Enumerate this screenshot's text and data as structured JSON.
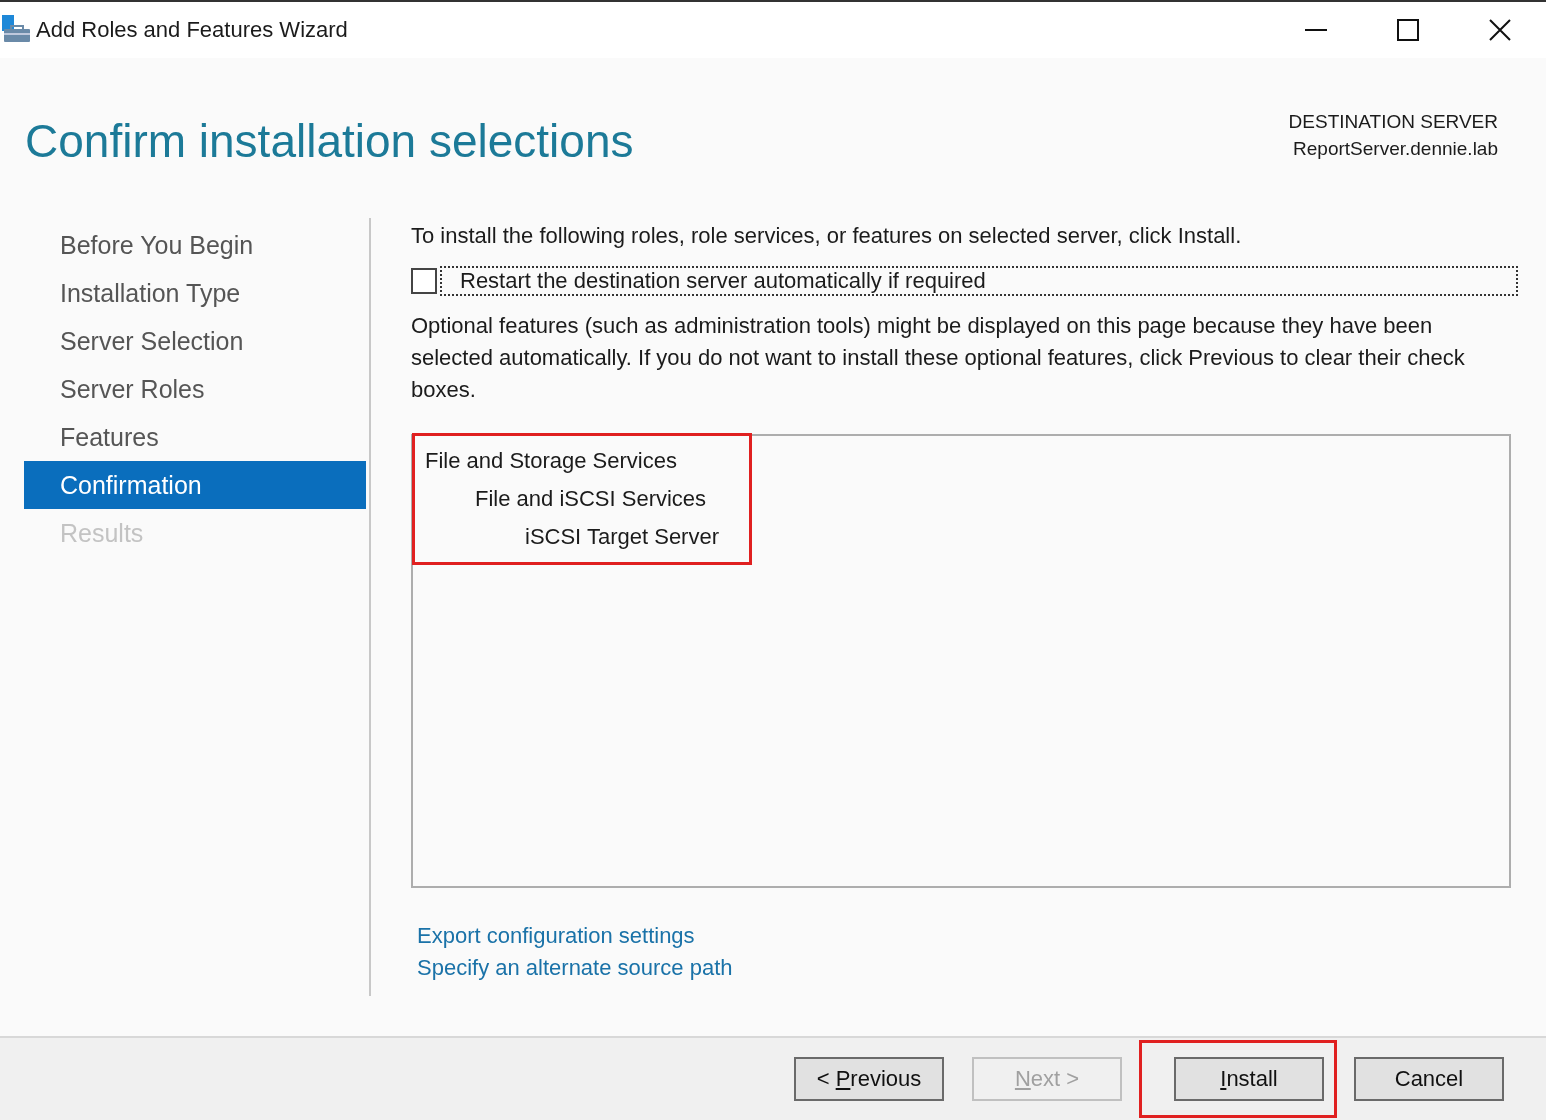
{
  "window": {
    "title": "Add Roles and Features Wizard"
  },
  "header": {
    "title": "Confirm installation selections",
    "destination_label": "DESTINATION SERVER",
    "destination_server": "ReportServer.dennie.lab"
  },
  "sidebar": {
    "items": [
      {
        "label": "Before You Begin",
        "selected": false,
        "disabled": false
      },
      {
        "label": "Installation Type",
        "selected": false,
        "disabled": false
      },
      {
        "label": "Server Selection",
        "selected": false,
        "disabled": false
      },
      {
        "label": "Server Roles",
        "selected": false,
        "disabled": false
      },
      {
        "label": "Features",
        "selected": false,
        "disabled": false
      },
      {
        "label": "Confirmation",
        "selected": true,
        "disabled": false
      },
      {
        "label": "Results",
        "selected": false,
        "disabled": true
      }
    ]
  },
  "intro": "To install the following roles, role services, or features on selected server, click Install.",
  "restart_checkbox": {
    "label": "Restart the destination server automatically if required",
    "checked": false
  },
  "note": "Optional features (such as administration tools) might be displayed on this page because they have been selected automatically. If you do not want to install these optional features, click Previous to clear their check boxes.",
  "selections": {
    "highlighted": true,
    "items": [
      {
        "label": "File and Storage Services",
        "children": [
          {
            "label": "File and iSCSI Services",
            "children": [
              {
                "label": "iSCSI Target Server"
              }
            ]
          }
        ]
      }
    ]
  },
  "links": [
    "Export configuration settings",
    "Specify an alternate source path"
  ],
  "buttons": [
    {
      "before": "< ",
      "key": "P",
      "after": "revious",
      "disabled": false,
      "highlighted": false
    },
    {
      "key": "N",
      "after": "ext >",
      "disabled": true,
      "highlighted": false
    },
    {
      "key": "I",
      "after": "nstall",
      "disabled": false,
      "highlighted": true
    },
    {
      "after": "Cancel",
      "disabled": false,
      "highlighted": false
    }
  ]
}
